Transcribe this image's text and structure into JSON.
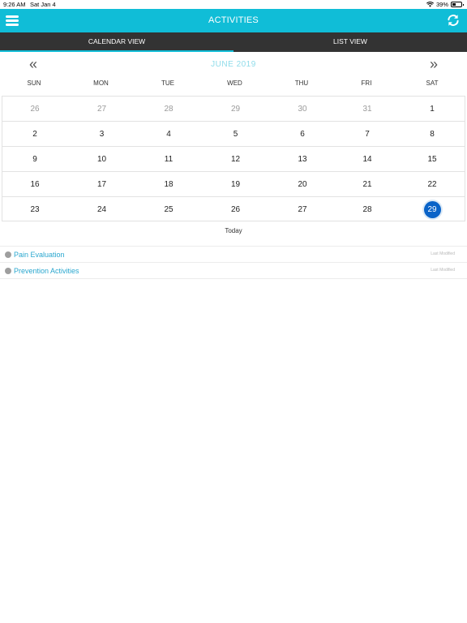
{
  "status": {
    "time": "9:26 AM",
    "date": "Sat Jan 4",
    "battery": "39%",
    "battery_level": 0.39
  },
  "header": {
    "title": "ACTIVITIES",
    "menu_icon": "hamburger-menu-icon",
    "refresh_icon": "refresh-icon"
  },
  "tabs": [
    {
      "label": "CALENDAR VIEW",
      "active": true
    },
    {
      "label": "LIST VIEW",
      "active": false
    }
  ],
  "calendar": {
    "month": "JUNE 2019",
    "prev": "«",
    "next": "»",
    "weekdays": [
      "SUN",
      "MON",
      "TUE",
      "WED",
      "THU",
      "FRI",
      "SAT"
    ],
    "weeks": [
      [
        {
          "d": "26",
          "m": true
        },
        {
          "d": "27",
          "m": true
        },
        {
          "d": "28",
          "m": true
        },
        {
          "d": "29",
          "m": true
        },
        {
          "d": "30",
          "m": true
        },
        {
          "d": "31",
          "m": true
        },
        {
          "d": "1"
        }
      ],
      [
        {
          "d": "2"
        },
        {
          "d": "3"
        },
        {
          "d": "4"
        },
        {
          "d": "5"
        },
        {
          "d": "6"
        },
        {
          "d": "7"
        },
        {
          "d": "8"
        }
      ],
      [
        {
          "d": "9"
        },
        {
          "d": "10"
        },
        {
          "d": "11"
        },
        {
          "d": "12"
        },
        {
          "d": "13"
        },
        {
          "d": "14"
        },
        {
          "d": "15"
        }
      ],
      [
        {
          "d": "16"
        },
        {
          "d": "17"
        },
        {
          "d": "18"
        },
        {
          "d": "19"
        },
        {
          "d": "20"
        },
        {
          "d": "21"
        },
        {
          "d": "22"
        }
      ],
      [
        {
          "d": "23"
        },
        {
          "d": "24"
        },
        {
          "d": "25"
        },
        {
          "d": "26"
        },
        {
          "d": "27"
        },
        {
          "d": "28"
        },
        {
          "d": "29",
          "sel": true
        }
      ]
    ],
    "today_label": "Today"
  },
  "activities": [
    {
      "label": "Pain Evaluation",
      "meta": "Last Modified"
    },
    {
      "label": "Prevention Activities",
      "meta": "Last Modified"
    }
  ],
  "colors": {
    "accent": "#10bdd7",
    "tabbar": "#333333",
    "selected": "#0a63c8",
    "link": "#2aa7cf"
  }
}
